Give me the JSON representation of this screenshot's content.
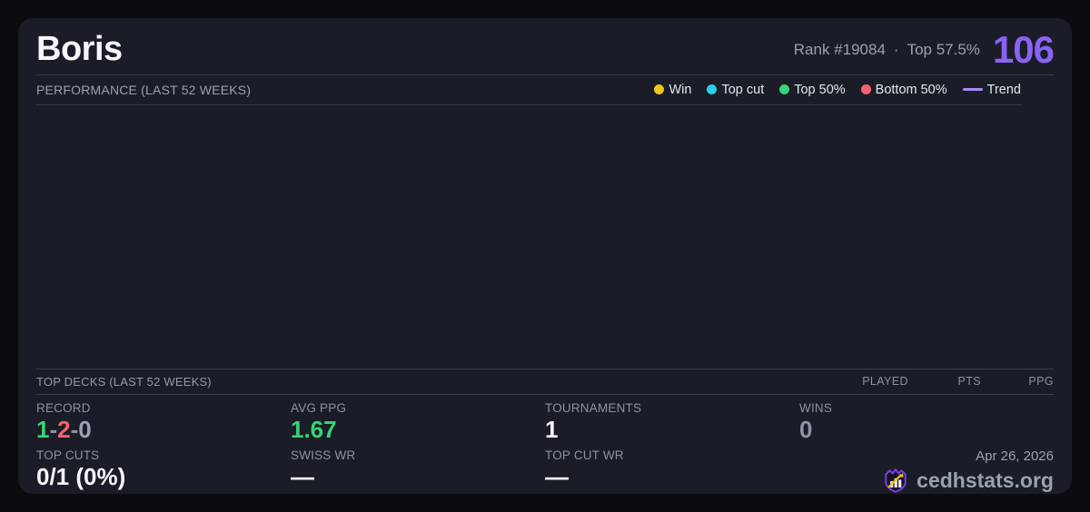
{
  "theme": {
    "page_bg": "#0b0c10",
    "card_bg": "#1a1d27",
    "accent_purple": "#8a63f5",
    "positive_green": "#38d475",
    "negative_red": "#f4646e",
    "muted_gray": "#99a1b3"
  },
  "header": {
    "title": "Boris",
    "rank": "Rank #19084",
    "dot_separator": "·",
    "percentile": "Top 57.5%",
    "score": "106"
  },
  "performance": {
    "heading": "PERFORMANCE (LAST 52 WEEKS)",
    "legend": [
      {
        "label": "Win",
        "color": "#f0c420"
      },
      {
        "label": "Top cut",
        "color": "#26d0e9"
      },
      {
        "label": "Top 50%",
        "color": "#37d27a"
      },
      {
        "label": "Bottom 50%",
        "color": "#f4646e"
      },
      {
        "label": "Trend",
        "color": "#a78bfa"
      }
    ]
  },
  "top_decks": {
    "heading": "TOP DECKS (LAST 52 WEEKS)",
    "columns": [
      "PLAYED",
      "PTS",
      "PPG"
    ],
    "rows": []
  },
  "stats": {
    "record": {
      "label": "RECORD",
      "parts": [
        {
          "text": "1",
          "color": "#38d475"
        },
        {
          "text": "-",
          "color": "#8a92a4"
        },
        {
          "text": "2",
          "color": "#f4646e"
        },
        {
          "text": "-",
          "color": "#8a92a4"
        },
        {
          "text": "0",
          "color": "#9aa1b2"
        }
      ]
    },
    "avg_ppg": {
      "label": "AVG PPG",
      "value": "1.67",
      "color": "#38d475"
    },
    "tournaments": {
      "label": "TOURNAMENTS",
      "value": "1",
      "color": "#f4f6f9"
    },
    "wins": {
      "label": "WINS",
      "value": "0",
      "color": "#8d94a6"
    },
    "top_cuts": {
      "label": "TOP CUTS",
      "value": "0/1 (0%)",
      "color": "#f4f6f9"
    },
    "swiss_wr": {
      "label": "SWISS WR",
      "value": "—",
      "color": "#f4f6f9"
    },
    "top_cut_wr": {
      "label": "TOP CUT WR",
      "value": "—",
      "color": "#f4f6f9"
    }
  },
  "footer": {
    "date": "Apr 26, 2026",
    "brand": "cedhstats.org"
  }
}
